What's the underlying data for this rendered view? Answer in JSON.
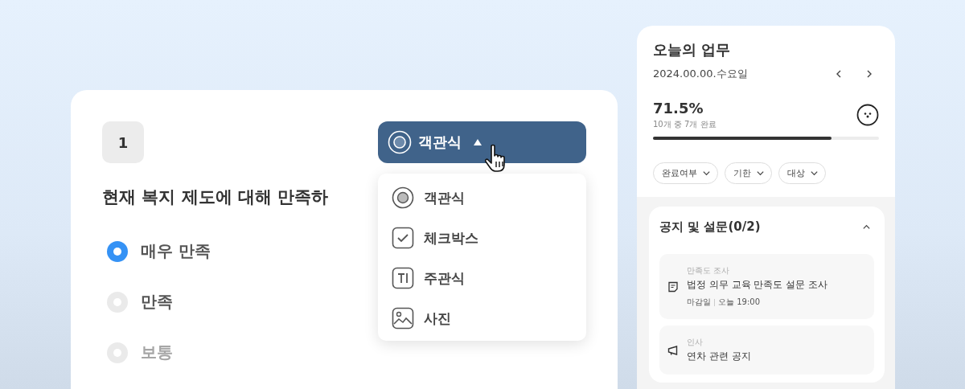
{
  "question": {
    "number": "1",
    "title": "현재 복지 제도에 대해 만족하",
    "type_button": {
      "label": "객관식",
      "expanded": true
    },
    "type_menu": [
      {
        "kind": "radio",
        "label": "객관식"
      },
      {
        "kind": "checkbox",
        "label": "체크박스"
      },
      {
        "kind": "text",
        "label": "주관식"
      },
      {
        "kind": "photo",
        "label": "사진"
      }
    ],
    "options": [
      {
        "label": "매우 만족",
        "selected": true
      },
      {
        "label": "만족",
        "selected": false
      },
      {
        "label": "보통",
        "selected": false
      }
    ]
  },
  "tasks": {
    "title": "오늘의 업무",
    "date": "2024.00.00.수요일",
    "percent": "71.5%",
    "summary": "10개 중 7개 완료",
    "level": 0.79,
    "filters": [
      "완료여부",
      "기한",
      "대상"
    ],
    "section": {
      "title": "공지 및 설문(0/2)",
      "expanded": true,
      "items": [
        {
          "kind": "survey",
          "category": "만족도 조사",
          "title": "법정 의무 교육 만족도 설문 조사",
          "deadline_label": "마감일",
          "deadline": "오늘 19:00"
        },
        {
          "kind": "notice",
          "category": "인사",
          "title": "연차 관련 공지"
        }
      ]
    }
  }
}
